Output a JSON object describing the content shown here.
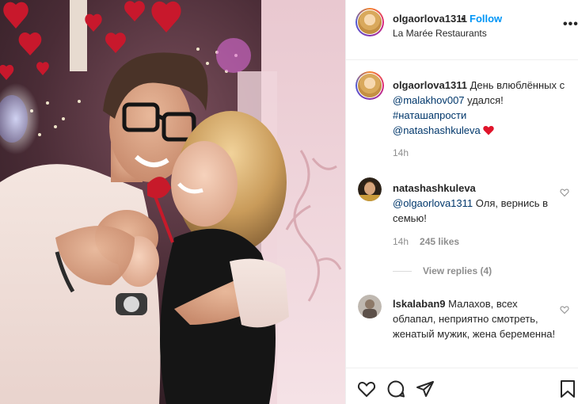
{
  "post": {
    "username": "olgaorlova1311",
    "separator": "•",
    "follow_label": "Follow",
    "location": "La Marée Restaurants",
    "more_icon": "more-options-icon"
  },
  "caption": {
    "username": "olgaorlova1311",
    "text_part1": "День влюблённых с",
    "mention": "@malakhov007",
    "text_part2": "удался!",
    "hashtag": "#наташапрости",
    "mention2": "@natashashkuleva",
    "emoji": "❤️",
    "time": "14h"
  },
  "comments": [
    {
      "username": "natashashkuleva",
      "mention": "@olgaorlova1311",
      "text": "Оля, вернись в семью!",
      "time": "14h",
      "likes": "245 likes",
      "replies": "View replies (4)"
    },
    {
      "username": "lskalaban9",
      "text": "Малахов, всех облапал, неприятно смотреть, женатый мужик, жена беременна!"
    }
  ],
  "actions": {
    "like_icon": "heart-icon",
    "comment_icon": "comment-icon",
    "share_icon": "share-icon",
    "save_icon": "bookmark-icon"
  },
  "colors": {
    "follow": "#0095f6",
    "mention": "#00376b",
    "muted": "#8e8e8e",
    "heart_emoji": "#e0142a"
  }
}
